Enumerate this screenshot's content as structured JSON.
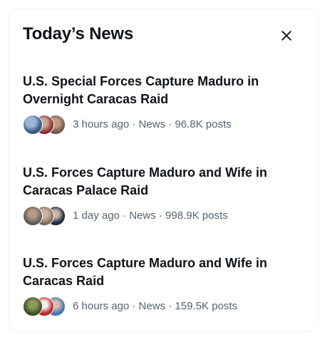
{
  "panel": {
    "title": "Today’s News",
    "close_icon": "close-icon"
  },
  "news": [
    {
      "title": "U.S. Special Forces Capture Maduro in Overnight Caracas Raid",
      "meta": "3 hours ago · News · 96.8K posts",
      "avatar_colors": [
        "#3b5b8a",
        "#8a2a35",
        "#6b5a4e"
      ]
    },
    {
      "title": "U.S. Forces Capture Maduro and Wife in Caracas Palace Raid",
      "meta": "1 day ago · News · 998.9K posts",
      "avatar_colors": [
        "#5a5a5a",
        "#7a6a5a",
        "#1f2a44"
      ]
    },
    {
      "title": "U.S. Forces Capture Maduro and Wife in Caracas Raid",
      "meta": "6 hours ago · News · 159.5K posts",
      "avatar_colors": [
        "#3d4a2a",
        "#c0272d",
        "#4a78b0"
      ]
    }
  ]
}
